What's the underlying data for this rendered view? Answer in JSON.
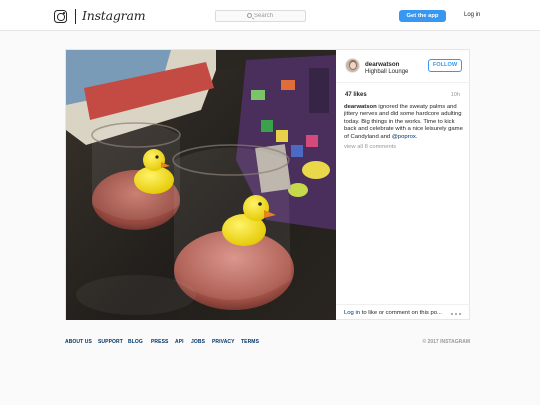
{
  "header": {
    "wordmark": "Instagram",
    "search_placeholder": "Search",
    "get_app_label": "Get the app",
    "login_label": "Log in"
  },
  "post": {
    "username": "dearwatson",
    "location": "Highball Lounge",
    "follow_label": "FOLLOW",
    "likes": "47 likes",
    "time": "10h",
    "caption_user": "dearwatson",
    "caption_text": "ignored the sweaty palms and jittery nerves and did some hardcore adulting today. Big things in the works. Time to kick back and celebrate with a nice leisurely game of Candyland and",
    "caption_mention": "@poprox",
    "caption_end": ".",
    "view_all": "view all 8 comments",
    "login_link": "Log in",
    "login_rest": "to like or comment on this po..."
  },
  "footer": {
    "links": [
      "ABOUT US",
      "SUPPORT",
      "BLOG",
      "PRESS",
      "API",
      "JOBS",
      "PRIVACY",
      "TERMS"
    ],
    "copyright": "© 2017 INSTAGRAM"
  },
  "colors": {
    "accent": "#3897f0",
    "link": "#003569",
    "muted": "#999999"
  }
}
